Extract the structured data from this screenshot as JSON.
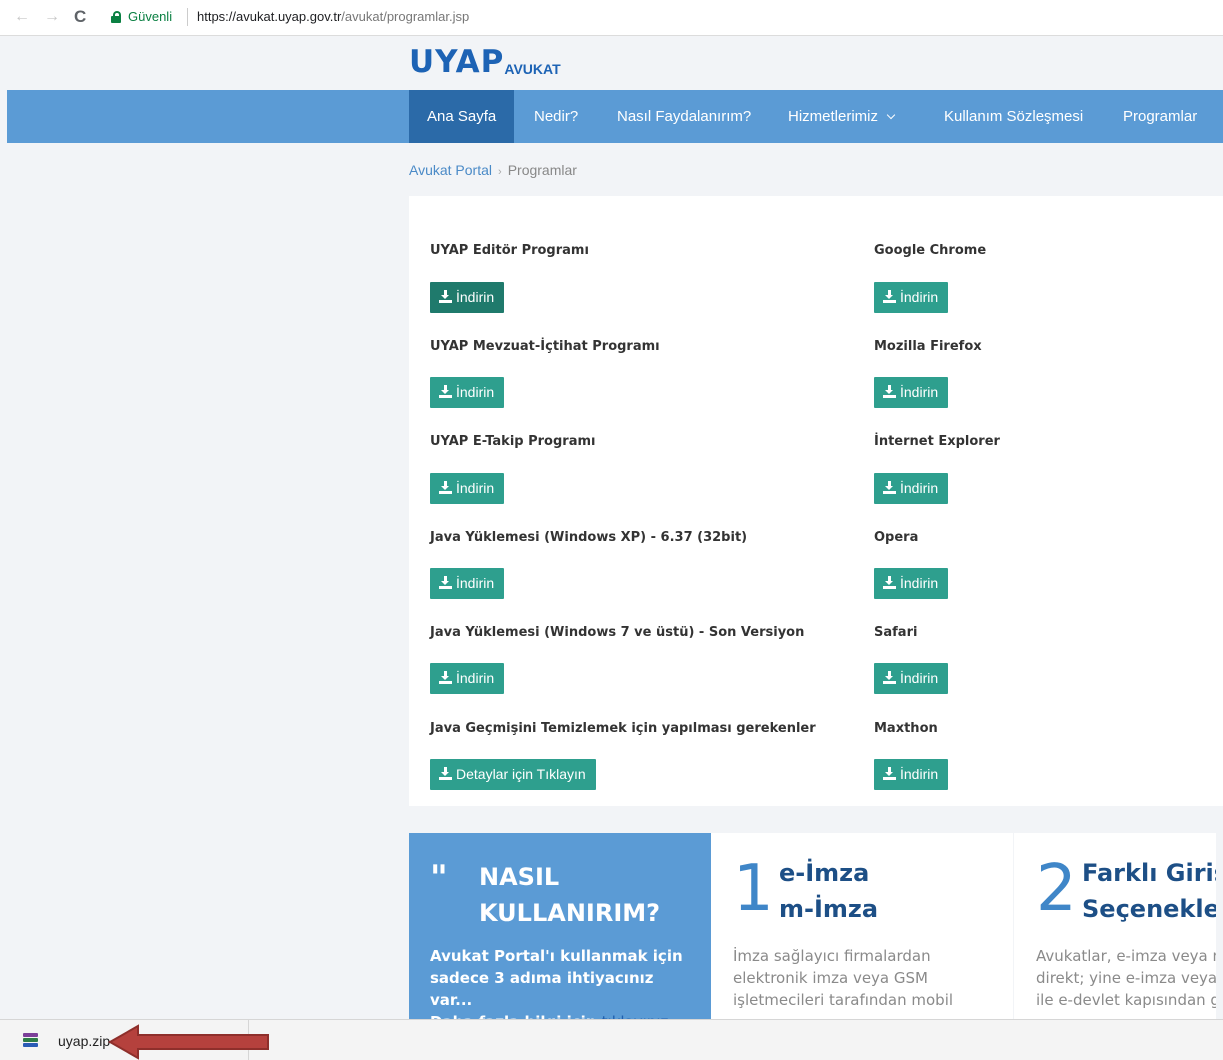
{
  "browser": {
    "back_icon": "←",
    "forward_icon": "→",
    "reload_icon": "C",
    "secure_label": "Güvenli",
    "url_prefix": "https://",
    "url_host": "avukat.uyap.gov.tr",
    "url_path": "/avukat/programlar.jsp"
  },
  "logo": {
    "main": "UYAP",
    "sub": "AVUKAT"
  },
  "nav": {
    "items": [
      "Ana Sayfa",
      "Nedir?",
      "Nasıl Faydalanırım?",
      "Hizmetlerimiz",
      "Kullanım Sözleşmesi",
      "Programlar"
    ]
  },
  "breadcrumb": {
    "root": "Avukat Portal",
    "sep": "›",
    "current": "Programlar"
  },
  "programs": {
    "left": [
      {
        "title": "UYAP Editör Programı",
        "button": "İndirin"
      },
      {
        "title": "UYAP Mevzuat-İçtihat Programı",
        "button": "İndirin"
      },
      {
        "title": "UYAP E-Takip Programı",
        "button": "İndirin"
      },
      {
        "title": "Java Yüklemesi (Windows XP) - 6.37 (32bit)",
        "button": "İndirin"
      },
      {
        "title": "Java Yüklemesi (Windows 7 ve üstü) - Son Versiyon",
        "button": "İndirin"
      },
      {
        "title": "Java Geçmişini Temizlemek için yapılması gerekenler",
        "button": "Detaylar için Tıklayın"
      }
    ],
    "right": [
      {
        "title": "Google Chrome",
        "button": "İndirin"
      },
      {
        "title": "Mozilla Firefox",
        "button": "İndirin"
      },
      {
        "title": "İnternet Explorer",
        "button": "İndirin"
      },
      {
        "title": "Opera",
        "button": "İndirin"
      },
      {
        "title": "Safari",
        "button": "İndirin"
      },
      {
        "title": "Maxthon",
        "button": "İndirin"
      }
    ]
  },
  "how_to": {
    "quote": "\"",
    "heading_line1": "NASIL",
    "heading_line2": "KULLANIRIM?",
    "body_line1": "Avukat Portal'ı kullanmak için",
    "body_line2": "sadece 3 adıma ihtiyacınız var...",
    "body_line3": "Daha fazla bilgi için",
    "link": "tıklayınız"
  },
  "step1": {
    "number": "1",
    "heading_line1": "e-İmza",
    "heading_line2": "m-İmza",
    "body_line1": "İmza sağlayıcı firmalardan",
    "body_line2": "elektronik imza veya GSM",
    "body_line3": "işletmecileri tarafından mobil"
  },
  "step2": {
    "number": "2",
    "heading_line1": "Farklı Giriş",
    "heading_line2": "Seçenekleri",
    "body_line1": "Avukatlar, e-imza veya m-",
    "body_line2": "direkt; yine e-imza veya",
    "body_line3": "ile e-devlet kapısından g"
  },
  "downloads": {
    "file_name": "uyap.zip"
  },
  "colors": {
    "nav_bg": "#5b9bd5",
    "nav_active": "#2b6aa8",
    "button": "#2e9f8e",
    "button_hover": "#1f7a6c",
    "arrow": "#b5413d"
  }
}
